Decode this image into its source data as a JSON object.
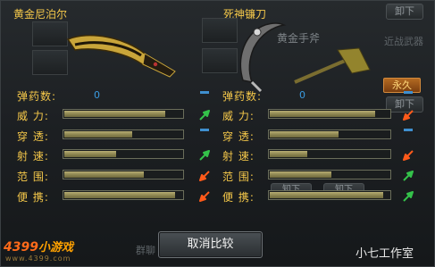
{
  "left_weapon": {
    "name": "黄金尼泊尔"
  },
  "right_weapon": {
    "name": "死神镰刀"
  },
  "background": {
    "unload_top": "卸下",
    "unload_mid": "卸下",
    "axe_name": "黄金手斧",
    "melee_weapon": "近战武器",
    "tab1": "知下",
    "tab2": "知下",
    "bottom_tab": "群聊"
  },
  "permanent_tag": "永久",
  "stats_left": [
    {
      "label": "弹药数:",
      "type": "value",
      "value": "0"
    },
    {
      "label": "威  力:",
      "type": "bar",
      "fill": 0.86
    },
    {
      "label": "穿  透:",
      "type": "bar",
      "fill": 0.58
    },
    {
      "label": "射  速:",
      "type": "bar",
      "fill": 0.45
    },
    {
      "label": "范  围:",
      "type": "bar",
      "fill": 0.68
    },
    {
      "label": "便  携:",
      "type": "bar",
      "fill": 0.94
    }
  ],
  "indicators_left": [
    "neutral",
    "up",
    "neutral",
    "up",
    "down",
    "down"
  ],
  "stats_right": [
    {
      "label": "弹药数:",
      "type": "value",
      "value": "0"
    },
    {
      "label": "威  力:",
      "type": "bar",
      "fill": 0.88
    },
    {
      "label": "穿  透:",
      "type": "bar",
      "fill": 0.58
    },
    {
      "label": "射  速:",
      "type": "bar",
      "fill": 0.32
    },
    {
      "label": "范  围:",
      "type": "bar",
      "fill": 0.52
    },
    {
      "label": "便  携:",
      "type": "bar",
      "fill": 0.95
    }
  ],
  "indicators_right": [
    "neutral",
    "down",
    "neutral",
    "down",
    "up",
    "up"
  ],
  "cancel_button": "取消比较",
  "logo": {
    "text": "4399",
    "suffix": "小游戏",
    "url": "www.4399.com"
  },
  "watermark": "小七工作室",
  "colors": {
    "label": "#f5c84a",
    "value": "#3a9be0",
    "bar": "#a09a5e",
    "up": "#34c24a",
    "down": "#ff5a1a"
  }
}
